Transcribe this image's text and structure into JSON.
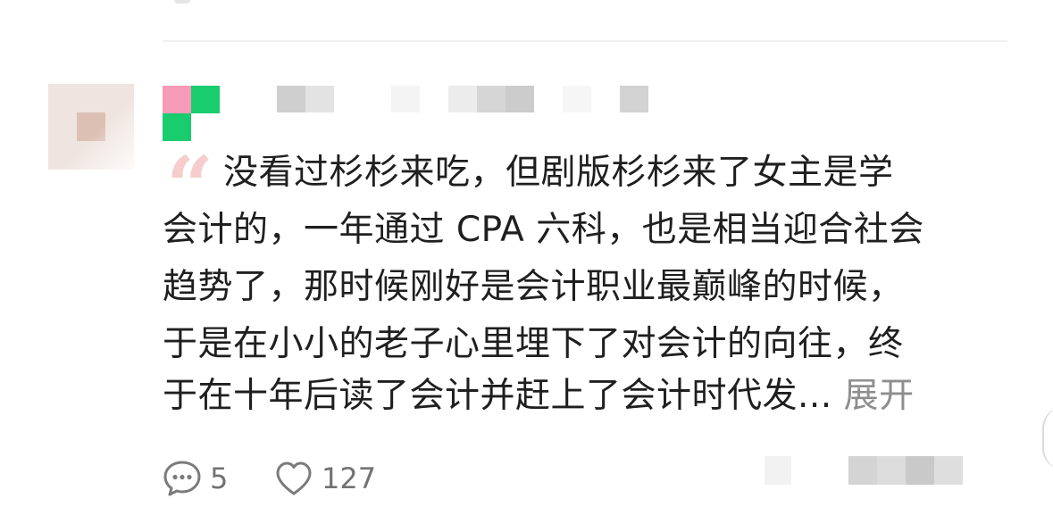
{
  "comment": {
    "lines": [
      "没看过杉杉来吃，但剧版杉杉来了女主是学",
      "会计的，一年通过 CPA 六科，也是相当迎合社会",
      "趋势了，那时候刚好是会计职业最巅峰的时候，",
      "于是在小小的老子心里埋下了对会计的向往，终",
      "于在十年后读了会计并赶上了会计时代发..."
    ],
    "expand_label": "展开"
  },
  "actions": {
    "reply_count": "5",
    "like_count": "127"
  },
  "icons": {
    "reply": "speech-bubble-icon",
    "like": "heart-icon",
    "quote": "quote-mark-icon"
  },
  "colors": {
    "quote_mark": "#f6cccc",
    "expand_link": "#8e8e8e",
    "name_pink": "#f59bb7",
    "name_green": "#19cc6e",
    "meta_gray": "#727272"
  }
}
